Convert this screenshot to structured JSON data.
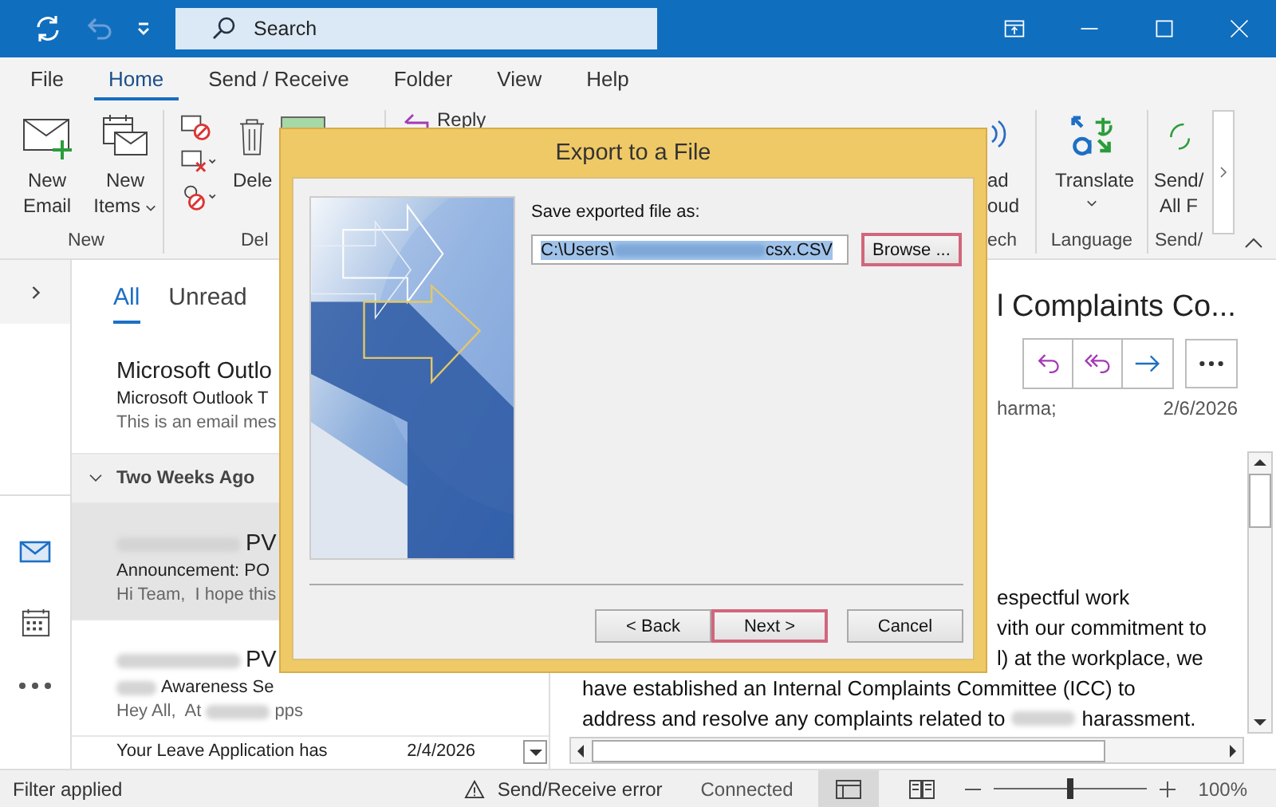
{
  "titlebar": {
    "search": {
      "placeholder": "Search"
    }
  },
  "tabs": [
    {
      "label": "File",
      "selected": false
    },
    {
      "label": "Home",
      "selected": true
    },
    {
      "label": "Send / Receive",
      "selected": false
    },
    {
      "label": "Folder",
      "selected": false
    },
    {
      "label": "View",
      "selected": false
    },
    {
      "label": "Help",
      "selected": false
    }
  ],
  "ribbon": {
    "new_email": "New Email",
    "new_items": "New Items",
    "group_new": "New",
    "delete": "Dele",
    "group_delete": "Del",
    "reply": "Reply",
    "read_aloud_1": "ad",
    "read_aloud_2": "oud",
    "group_speech": "ech",
    "translate": "Translate",
    "group_language": "Language",
    "send_all_1": "Send/",
    "send_all_2": "All F",
    "group_send": "Send/"
  },
  "mail_list": {
    "filters": [
      {
        "label": "All",
        "selected": true
      },
      {
        "label": "Unread",
        "selected": false
      }
    ],
    "top": {
      "sender": "Microsoft Outlo",
      "subject": "Microsoft Outlook T",
      "preview": "This is an email mes"
    },
    "group": "Two Weeks Ago",
    "items": [
      {
        "sender": "PV",
        "subject": "Announcement: PO",
        "preview": "Hi Team,  I hope this",
        "selected": true
      },
      {
        "sender": "PV",
        "subject": "Awareness Se",
        "preview": "Hey All,  At",
        "preview_end": "pps",
        "selected": false
      }
    ],
    "last": {
      "subject": "Your Leave Application has",
      "date": "2/4/2026"
    }
  },
  "reading": {
    "title": "l Complaints Co...",
    "to": "harma;",
    "date": "2/6/2026",
    "lines": [
      "espectful work",
      "vith our commitment to",
      "l) at the workplace, we"
    ],
    "full_line": "have established an Internal Complaints Committee (ICC) to",
    "last_line_start": "address and resolve any complaints related to",
    "last_line_end": "harassment."
  },
  "status": {
    "left": "Filter applied",
    "error": "Send/Receive error",
    "connection": "Connected",
    "zoom": {
      "level": 0.5
    },
    "zoom_text": "100%"
  },
  "dialog": {
    "title": "Export to a File",
    "label": "Save exported file as:",
    "value_start": "C:\\Users\\",
    "value_end": "csx.CSV",
    "buttons": [
      {
        "label": "Browse ...",
        "highlighted": true
      },
      {
        "label": "< Back",
        "highlighted": false
      },
      {
        "label": "Next >",
        "highlighted": true
      },
      {
        "label": "Cancel",
        "highlighted": false
      }
    ]
  }
}
